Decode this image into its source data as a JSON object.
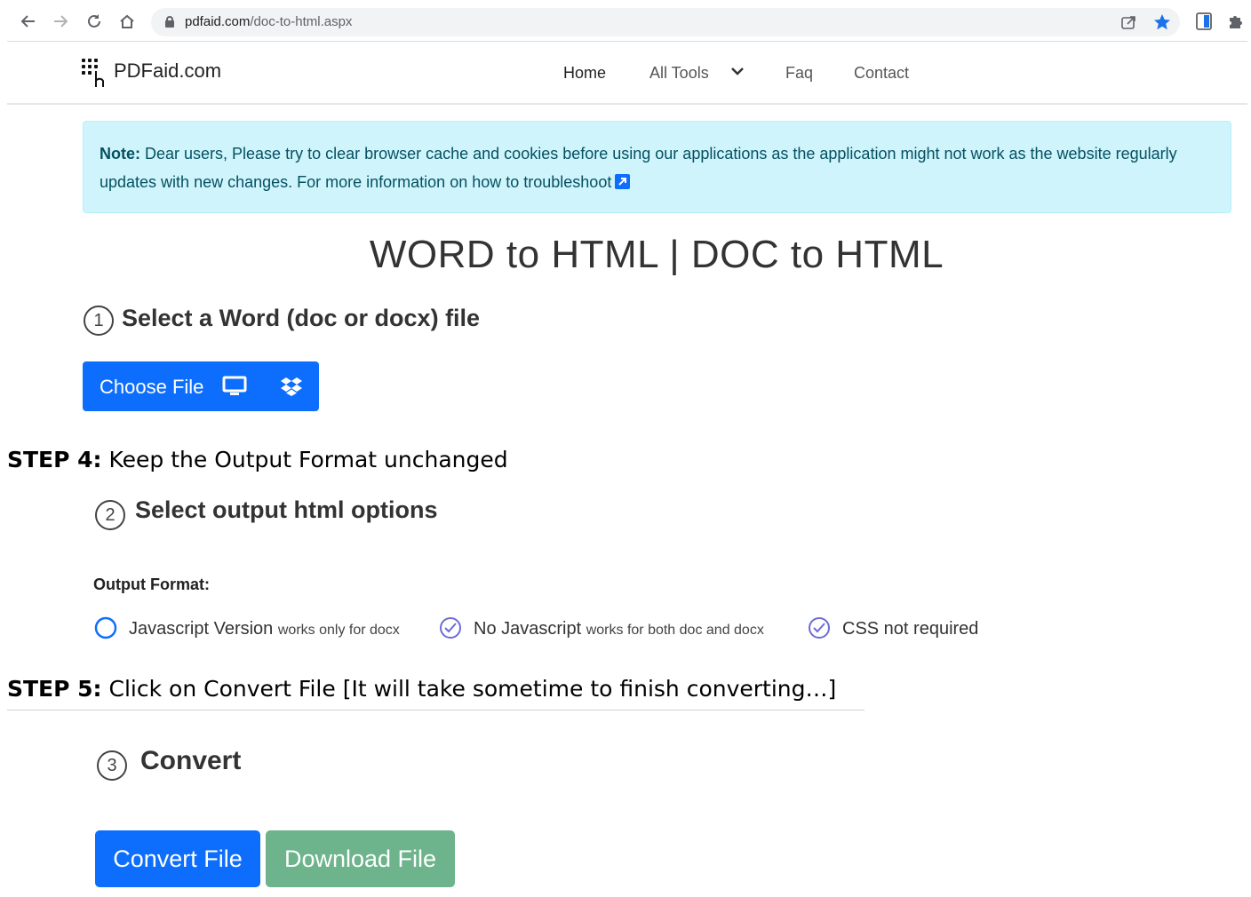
{
  "browser": {
    "url_domain": "pdfaid.com",
    "url_path": "/doc-to-html.aspx"
  },
  "header": {
    "logo_text": "PDFaid.com",
    "nav": {
      "home": "Home",
      "all_tools": "All Tools",
      "faq": "Faq",
      "contact": "Contact"
    }
  },
  "alert": {
    "label": "Note:",
    "text": " Dear users, Please try to clear browser cache and cookies before using our applications as the application might not work as the website regularly updates with new changes. For more information on how to troubleshoot"
  },
  "page": {
    "title": "WORD to HTML | DOC to HTML"
  },
  "step1": {
    "number": "1",
    "title": "Select a Word (doc or docx) file",
    "choose_file_label": "Choose File"
  },
  "instructions": {
    "step4_label": "STEP 4:",
    "step4_text": " Keep the Output Format unchanged",
    "step5_label": "STEP 5:",
    "step5_text": " Click on Convert File [It will take sometime to finish converting…]"
  },
  "step2": {
    "number": "2",
    "title": "Select output html options",
    "output_format_label": "Output Format:",
    "options": [
      {
        "label": "Javascript Version",
        "note": "works only for docx",
        "state": "unchecked"
      },
      {
        "label": "No Javascript",
        "note": "works for both doc and docx",
        "state": "checked"
      },
      {
        "label": "CSS not required",
        "note": "",
        "state": "checked"
      }
    ]
  },
  "step3": {
    "number": "3",
    "title": "Convert",
    "convert_label": "Convert File",
    "download_label": "Download File"
  },
  "colors": {
    "primary": "#0d6efd",
    "download_button": "#6db38c",
    "alert_bg": "#cff4fc",
    "alert_text": "#055160",
    "star": "#1a73e8"
  }
}
